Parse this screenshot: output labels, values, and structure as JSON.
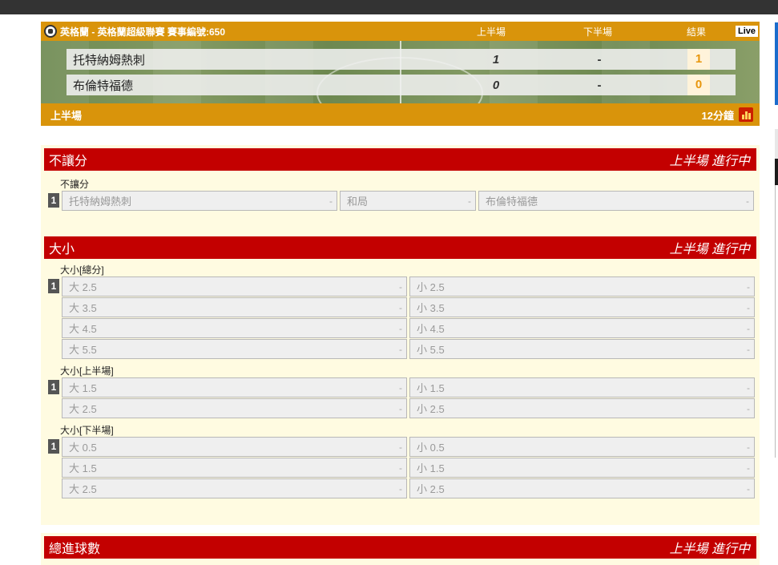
{
  "colors": {
    "header_orange": "#d9940b",
    "section_red": "#c30000",
    "section_bg": "#fffbe1",
    "result_orange": "#e8960d"
  },
  "match": {
    "title": "英格蘭 - 英格蘭超級聯賽 賽事編號:650",
    "col_first_half": "上半場",
    "col_second_half": "下半場",
    "col_result": "結果",
    "live_badge": "Live",
    "teams": [
      {
        "name": "托特納姆熱刺",
        "first_half": "1",
        "second_half": "-",
        "result": "1"
      },
      {
        "name": "布倫特福德",
        "first_half": "0",
        "second_half": "-",
        "result": "0"
      }
    ],
    "period": "上半場",
    "minutes": "12分鐘",
    "ball_icon": "soccer-ball-icon",
    "stats_icon": "bar-chart-icon"
  },
  "sections": {
    "no_handicap": {
      "title": "不讓分",
      "status": "上半場 進行中",
      "sub_label": "不讓分",
      "badge": "1",
      "options": [
        {
          "label": "托特納姆熱刺",
          "odds": "-"
        },
        {
          "label": "和局",
          "odds": "-"
        },
        {
          "label": "布倫特福德",
          "odds": "-"
        }
      ]
    },
    "over_under": {
      "title": "大小",
      "status": "上半場 進行中",
      "groups": [
        {
          "label": "大小[總分]",
          "badge": "1",
          "rows": [
            {
              "over": "大 2.5",
              "over_odds": "-",
              "under": "小 2.5",
              "under_odds": "-"
            },
            {
              "over": "大 3.5",
              "over_odds": "-",
              "under": "小 3.5",
              "under_odds": "-"
            },
            {
              "over": "大 4.5",
              "over_odds": "-",
              "under": "小 4.5",
              "under_odds": "-"
            },
            {
              "over": "大 5.5",
              "over_odds": "-",
              "under": "小 5.5",
              "under_odds": "-"
            }
          ]
        },
        {
          "label": "大小[上半場]",
          "badge": "1",
          "rows": [
            {
              "over": "大 1.5",
              "over_odds": "-",
              "under": "小 1.5",
              "under_odds": "-"
            },
            {
              "over": "大 2.5",
              "over_odds": "-",
              "under": "小 2.5",
              "under_odds": "-"
            }
          ]
        },
        {
          "label": "大小[下半場]",
          "badge": "1",
          "rows": [
            {
              "over": "大 0.5",
              "over_odds": "-",
              "under": "小 0.5",
              "under_odds": "-"
            },
            {
              "over": "大 1.5",
              "over_odds": "-",
              "under": "小 1.5",
              "under_odds": "-"
            },
            {
              "over": "大 2.5",
              "over_odds": "-",
              "under": "小 2.5",
              "under_odds": "-"
            }
          ]
        }
      ]
    },
    "total_goals": {
      "title": "總進球數",
      "status": "上半場 進行中"
    }
  }
}
